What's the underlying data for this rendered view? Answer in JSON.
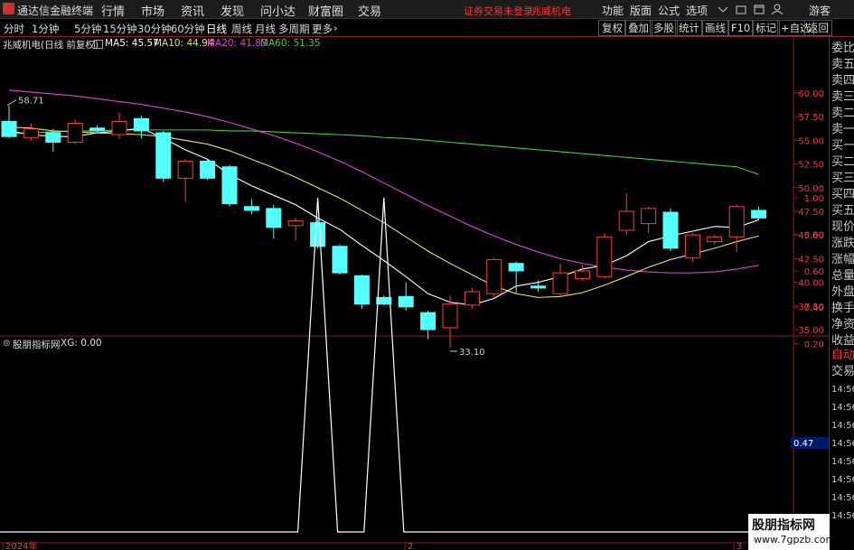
{
  "app": {
    "title": "通达信金融终端",
    "menu": [
      "行情",
      "市场",
      "资讯",
      "发现",
      "问小达",
      "财富圈",
      "交易"
    ],
    "warning": "证券交易未登录",
    "stock_name": "兆威机电",
    "right_menu": [
      "功能",
      "版面",
      "公式",
      "选项"
    ],
    "user": "游客"
  },
  "tabs": {
    "periods": [
      "分时",
      "1分钟",
      "5分钟",
      "15分钟",
      "30分钟",
      "60分钟",
      "日线",
      "周线",
      "月线",
      "多周期",
      "更多"
    ],
    "active": "日线",
    "right": [
      "复权",
      "叠加",
      "多股",
      "统计",
      "画线",
      "F10",
      "标记",
      "+自选",
      "返回"
    ]
  },
  "chart_header": {
    "title": "兆威机电(日线 前复权)",
    "ma5": "MA5: 45.57",
    "ma10": "MA10: 44.94",
    "ma20": "MA20: 41.83",
    "ma60": "MA60: 51.35"
  },
  "price_axis": [
    "60.00",
    "57.50",
    "55.00",
    "52.50",
    "50.00",
    "47.50",
    "45.00",
    "42.50",
    "40.00",
    "37.50",
    "35.00"
  ],
  "price_markers": {
    "high": "58.71",
    "low": "33.10"
  },
  "side_panel": [
    "委比",
    "卖五",
    "卖四",
    "卖三",
    "卖二",
    "卖一",
    "买一",
    "买二",
    "买三",
    "买四",
    "买五",
    "现价",
    "涨跌",
    "涨幅",
    "总量",
    "外盘",
    "换手",
    "净资",
    "收益"
  ],
  "side_panel_lower": [
    "自动",
    "交易",
    "14:56",
    "14:56",
    "14:56",
    "14:56",
    "14:56",
    "14:56",
    "14:56",
    "14:56"
  ],
  "indicator": {
    "name": "股朋指标网",
    "value": "XG: 0.00",
    "axis": [
      "1.00",
      "0.80",
      "0.60",
      "0.40",
      "0.20"
    ],
    "current": "0.47"
  },
  "time_axis": [
    "2024年",
    "2",
    "3"
  ],
  "watermark": {
    "line1": "股朋指标网",
    "line2": "www.7gpzb.com"
  },
  "colors": {
    "up": "#ff3c3c",
    "down": "#54ffff",
    "ma5": "#ffffff",
    "ma10": "#e8e060",
    "ma20": "#e040e0",
    "ma60": "#40d040",
    "frame": "#8b1d1d"
  },
  "chart_data": {
    "type": "candlestick",
    "candles": [
      {
        "o": 57,
        "h": 58.7,
        "l": 55.2,
        "c": 55.4
      },
      {
        "o": 55.3,
        "h": 56.8,
        "l": 55.0,
        "c": 56.2
      },
      {
        "o": 55.8,
        "h": 56.2,
        "l": 53.8,
        "c": 54.8
      },
      {
        "o": 54.8,
        "h": 57.2,
        "l": 54.6,
        "c": 56.8
      },
      {
        "o": 56.3,
        "h": 56.6,
        "l": 55.8,
        "c": 56.0
      },
      {
        "o": 55.6,
        "h": 58.0,
        "l": 55.2,
        "c": 57.0
      },
      {
        "o": 57.3,
        "h": 57.6,
        "l": 55.2,
        "c": 56.0
      },
      {
        "o": 55.8,
        "h": 56.0,
        "l": 50.6,
        "c": 51.0
      },
      {
        "o": 51.0,
        "h": 53.0,
        "l": 48.5,
        "c": 52.8
      },
      {
        "o": 52.8,
        "h": 53.0,
        "l": 50.8,
        "c": 51.0
      },
      {
        "o": 52.2,
        "h": 52.4,
        "l": 48.0,
        "c": 48.3
      },
      {
        "o": 48.0,
        "h": 48.8,
        "l": 47.2,
        "c": 47.6
      },
      {
        "o": 47.8,
        "h": 48.2,
        "l": 44.6,
        "c": 45.8
      },
      {
        "o": 46.0,
        "h": 46.8,
        "l": 44.4,
        "c": 46.5
      },
      {
        "o": 46.3,
        "h": 46.6,
        "l": 43.6,
        "c": 43.8
      },
      {
        "o": 43.8,
        "h": 44.0,
        "l": 40.8,
        "c": 41.0
      },
      {
        "o": 40.7,
        "h": 40.8,
        "l": 37.2,
        "c": 37.7
      },
      {
        "o": 38.4,
        "h": 38.6,
        "l": 37.6,
        "c": 37.7
      },
      {
        "o": 38.5,
        "h": 40.0,
        "l": 37.0,
        "c": 37.4
      },
      {
        "o": 36.8,
        "h": 37.0,
        "l": 34.0,
        "c": 35.0
      },
      {
        "o": 35.2,
        "h": 38.6,
        "l": 33.1,
        "c": 37.7
      },
      {
        "o": 37.6,
        "h": 39.4,
        "l": 37.2,
        "c": 39.0
      },
      {
        "o": 38.8,
        "h": 42.6,
        "l": 38.4,
        "c": 42.4
      },
      {
        "o": 42.0,
        "h": 42.2,
        "l": 38.9,
        "c": 41.2
      },
      {
        "o": 39.6,
        "h": 40.2,
        "l": 39.0,
        "c": 39.4
      },
      {
        "o": 38.8,
        "h": 42.0,
        "l": 38.6,
        "c": 41.0
      },
      {
        "o": 40.4,
        "h": 41.8,
        "l": 40.2,
        "c": 41.2
      },
      {
        "o": 40.6,
        "h": 45.2,
        "l": 40.4,
        "c": 44.8
      },
      {
        "o": 45.5,
        "h": 49.4,
        "l": 45.0,
        "c": 47.5
      },
      {
        "o": 46.2,
        "h": 48.0,
        "l": 45.2,
        "c": 47.8
      },
      {
        "o": 47.4,
        "h": 47.8,
        "l": 43.3,
        "c": 43.6
      },
      {
        "o": 42.6,
        "h": 45.2,
        "l": 42.2,
        "c": 45.0
      },
      {
        "o": 44.3,
        "h": 45.0,
        "l": 44.0,
        "c": 44.8
      },
      {
        "o": 44.8,
        "h": 48.2,
        "l": 43.2,
        "c": 48.0
      },
      {
        "o": 47.6,
        "h": 48.0,
        "l": 46.6,
        "c": 46.8
      }
    ],
    "ma5": [
      56.0,
      55.6,
      55.4,
      55.4,
      55.8,
      56.0,
      56.3,
      55.2,
      54.0,
      53.0,
      51.4,
      50.2,
      49.2,
      48.2,
      46.8,
      45.6,
      43.9,
      42.3,
      40.6,
      38.8,
      37.9,
      37.6,
      38.3,
      39.6,
      40.0,
      40.6,
      41.4,
      41.8,
      42.8,
      44.3,
      44.9,
      45.4,
      45.9,
      45.8,
      46.6
    ],
    "ma10": [
      56.4,
      56.3,
      56.0,
      55.9,
      55.8,
      55.7,
      55.6,
      55.4,
      55.0,
      54.6,
      53.9,
      53.0,
      52.1,
      51.1,
      50.0,
      48.9,
      47.6,
      46.3,
      44.8,
      43.3,
      42.0,
      40.8,
      39.6,
      38.8,
      38.4,
      38.5,
      38.9,
      39.7,
      40.6,
      41.6,
      42.4,
      43.0,
      43.6,
      44.3,
      44.9
    ],
    "ma20": [
      60.3,
      60.1,
      59.9,
      59.7,
      59.4,
      59.1,
      58.8,
      58.4,
      58.0,
      57.5,
      56.9,
      56.2,
      55.5,
      54.7,
      53.8,
      52.8,
      51.7,
      50.5,
      49.3,
      48.1,
      47.0,
      45.9,
      44.9,
      44.0,
      43.2,
      42.5,
      42.0,
      41.6,
      41.3,
      41.1,
      41.0,
      41.0,
      41.1,
      41.4,
      41.8
    ],
    "ma60": [
      55.7,
      55.8,
      55.9,
      56.0,
      56.0,
      56.1,
      56.1,
      56.1,
      56.1,
      56.1,
      56.0,
      56.0,
      55.9,
      55.8,
      55.7,
      55.6,
      55.5,
      55.3,
      55.2,
      55.0,
      54.8,
      54.6,
      54.4,
      54.2,
      54.0,
      53.8,
      53.6,
      53.4,
      53.2,
      53.0,
      52.8,
      52.6,
      52.4,
      52.2,
      51.4
    ],
    "xg_signal_candle_indices": [
      14,
      17
    ],
    "ylim": [
      33,
      61
    ]
  }
}
